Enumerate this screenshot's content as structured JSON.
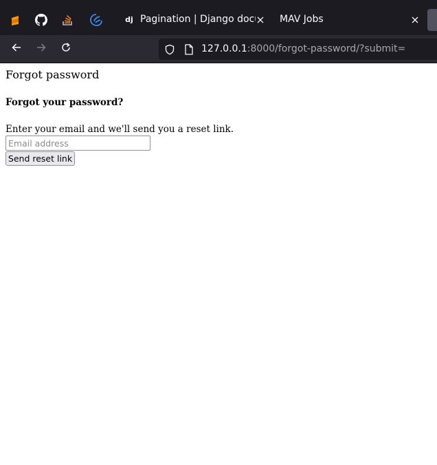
{
  "browser": {
    "pinned_tabs": [
      {
        "icon": "sublime-text-icon",
        "color": "#ff9800"
      },
      {
        "icon": "github-icon",
        "color": "#ffffff"
      },
      {
        "icon": "stackoverflow-icon",
        "color": "#f48024"
      },
      {
        "icon": "app-logo-icon",
        "color": "#3b8beb"
      }
    ],
    "tabs": [
      {
        "favicon_text": "dj",
        "title": "Pagination | Django documentation",
        "has_close": true
      },
      {
        "title": "MAV Jobs",
        "has_close": true
      }
    ],
    "nav": {
      "back_icon": "arrow-left-icon",
      "forward_icon": "arrow-right-icon",
      "reload_icon": "reload-icon"
    },
    "url": {
      "host": "127.0.0.1",
      "rest": ":8000/forgot-password/?submit="
    }
  },
  "page": {
    "title": "Forgot password",
    "form": {
      "heading": "Forgot your password?",
      "instructions": "Enter your email and we'll send you a reset link.",
      "email_placeholder": "Email address",
      "email_value": "",
      "submit_label": "Send reset link"
    }
  }
}
